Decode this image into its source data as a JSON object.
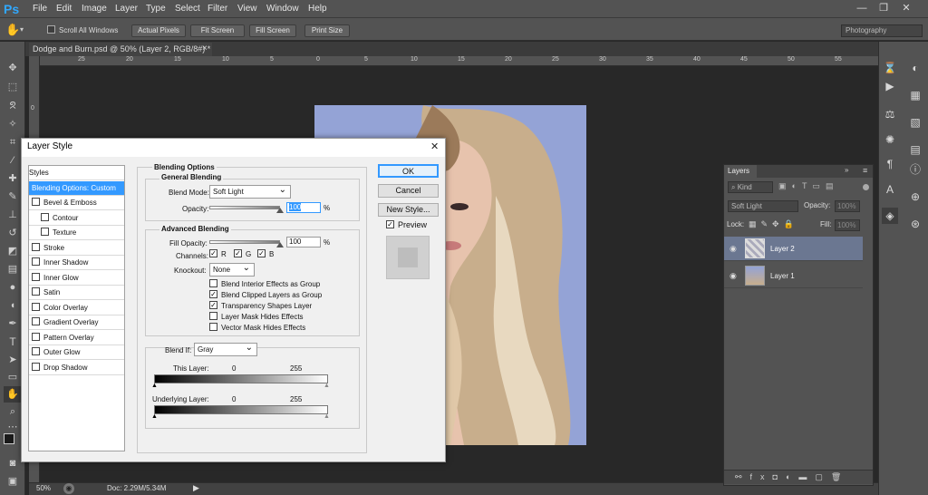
{
  "app": {
    "logo": "Ps",
    "menu": [
      "File",
      "Edit",
      "Image",
      "Layer",
      "Type",
      "Select",
      "Filter",
      "View",
      "Window",
      "Help"
    ],
    "window_buttons": [
      "—",
      "❐",
      "✕"
    ]
  },
  "options": {
    "scroll_all": "Scroll All Windows",
    "buttons": [
      "Actual Pixels",
      "Fit Screen",
      "Fill Screen",
      "Print Size"
    ],
    "workspace": "Photography"
  },
  "document": {
    "tab": "Dodge and Burn.psd @ 50% (Layer 2, RGB/8#) *",
    "close": "×",
    "zoom": "50%",
    "doc_size": "Doc: 2.29M/5.34M"
  },
  "ruler": {
    "top": [
      "25",
      "20",
      "15",
      "10",
      "5",
      "0",
      "5",
      "10",
      "15",
      "20",
      "25",
      "30",
      "35",
      "40",
      "45",
      "50",
      "55"
    ],
    "left": [
      "0"
    ]
  },
  "layers": {
    "title": "Layers",
    "kind": "Kind",
    "blend": "Soft Light",
    "opacity_label": "Opacity:",
    "opacity": "100%",
    "lock": "Lock:",
    "fill_label": "Fill:",
    "fill": "100%",
    "items": [
      {
        "name": "Layer 2"
      },
      {
        "name": "Layer 1"
      }
    ]
  },
  "dialog": {
    "title": "Layer Style",
    "close": "✕",
    "styles_header": "Styles",
    "styles": [
      {
        "label": "Blending Options: Custom",
        "checkbox": false,
        "indent": false,
        "selected": true
      },
      {
        "label": "Bevel & Emboss",
        "checkbox": true,
        "indent": false
      },
      {
        "label": "Contour",
        "checkbox": true,
        "indent": true
      },
      {
        "label": "Texture",
        "checkbox": true,
        "indent": true
      },
      {
        "label": "Stroke",
        "checkbox": true,
        "indent": false
      },
      {
        "label": "Inner Shadow",
        "checkbox": true,
        "indent": false
      },
      {
        "label": "Inner Glow",
        "checkbox": true,
        "indent": false
      },
      {
        "label": "Satin",
        "checkbox": true,
        "indent": false
      },
      {
        "label": "Color Overlay",
        "checkbox": true,
        "indent": false
      },
      {
        "label": "Gradient Overlay",
        "checkbox": true,
        "indent": false
      },
      {
        "label": "Pattern Overlay",
        "checkbox": true,
        "indent": false
      },
      {
        "label": "Outer Glow",
        "checkbox": true,
        "indent": false
      },
      {
        "label": "Drop Shadow",
        "checkbox": true,
        "indent": false
      }
    ],
    "blending_options": "Blending Options",
    "general_blending": "General Blending",
    "blend_mode_label": "Blend Mode:",
    "blend_mode": "Soft Light",
    "opacity_label": "Opacity:",
    "opacity": "100",
    "percent": "%",
    "advanced_blending": "Advanced Blending",
    "fill_opacity_label": "Fill Opacity:",
    "fill_opacity": "100",
    "channels_label": "Channels:",
    "channels": [
      "R",
      "G",
      "B"
    ],
    "knockout_label": "Knockout:",
    "knockout": "None",
    "options": [
      {
        "label": "Blend Interior Effects as Group",
        "checked": false
      },
      {
        "label": "Blend Clipped Layers as Group",
        "checked": true
      },
      {
        "label": "Transparency Shapes Layer",
        "checked": true
      },
      {
        "label": "Layer Mask Hides Effects",
        "checked": false
      },
      {
        "label": "Vector Mask Hides Effects",
        "checked": false
      }
    ],
    "blend_if_label": "Blend If:",
    "blend_if": "Gray",
    "this_layer": "This Layer:",
    "underlying_layer": "Underlying Layer:",
    "min": "0",
    "max": "255",
    "ok": "OK",
    "cancel": "Cancel",
    "new_style": "New Style...",
    "preview": "Preview"
  }
}
